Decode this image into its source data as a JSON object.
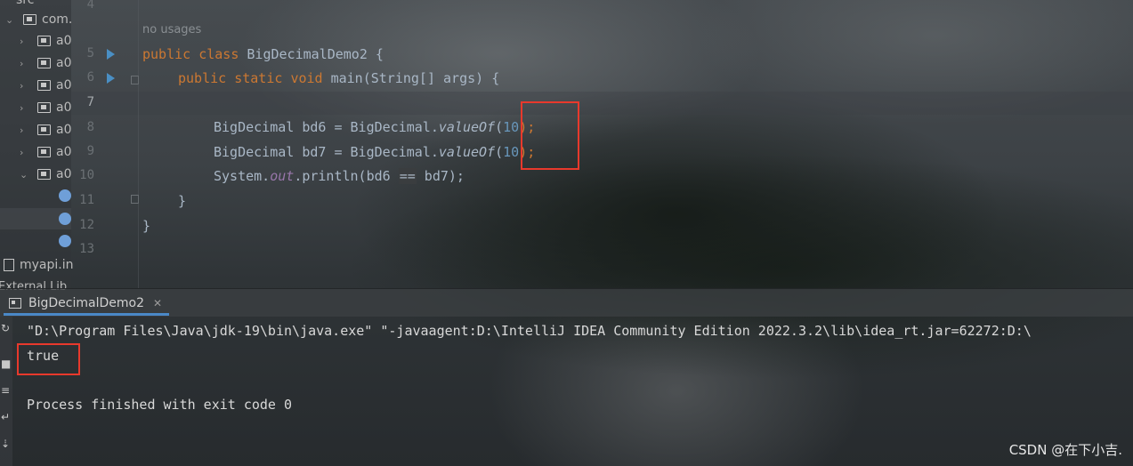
{
  "project_tree": {
    "top_partial": "src",
    "package_label": "com.",
    "folders": [
      "a0",
      "a0",
      "a0",
      "a0",
      "a0",
      "a0",
      "a0"
    ],
    "file_label": "myapi.in",
    "external_label": "External Lib"
  },
  "editor": {
    "usage_hint": "no usages",
    "line_numbers": [
      "4",
      "5",
      "6",
      "7",
      "8",
      "9",
      "10",
      "11",
      "12",
      "13"
    ],
    "code": {
      "l5_kw1": "public",
      "l5_kw2": "class",
      "l5_rest": " BigDecimalDemo2 {",
      "l6_kw1": "public",
      "l6_kw2": "static",
      "l6_kw3": "void",
      "l6_rest": " main(String[] args) {",
      "l8_pre": "BigDecimal bd6 = BigDecimal.",
      "l8_method": "valueOf",
      "l8_open": "(",
      "l8_num": "10",
      "l8_close": ");",
      "l9_pre": "BigDecimal bd7 = BigDecimal.",
      "l9_method": "valueOf",
      "l9_open": "(",
      "l9_num": "10",
      "l9_close": ");",
      "l10_pre": "System.",
      "l10_field": "out",
      "l10_mid": ".println(bd6 ",
      "l10_op": "==",
      "l10_post": " bd7);",
      "l11": "}",
      "l12": "}"
    }
  },
  "run_panel": {
    "tab_label": "BigDecimalDemo2",
    "console": {
      "command": "\"D:\\Program Files\\Java\\jdk-19\\bin\\java.exe\" \"-javaagent:D:\\IntelliJ IDEA Community Edition 2022.3.2\\lib\\idea_rt.jar=62272:D:\\",
      "output": "true",
      "exit_message": "Process finished with exit code 0"
    }
  },
  "watermark": "CSDN @在下小吉.",
  "colors": {
    "keyword": "#cc7832",
    "number": "#6897bb",
    "text": "#a9b7c6",
    "highlight_box": "#e8392c"
  }
}
